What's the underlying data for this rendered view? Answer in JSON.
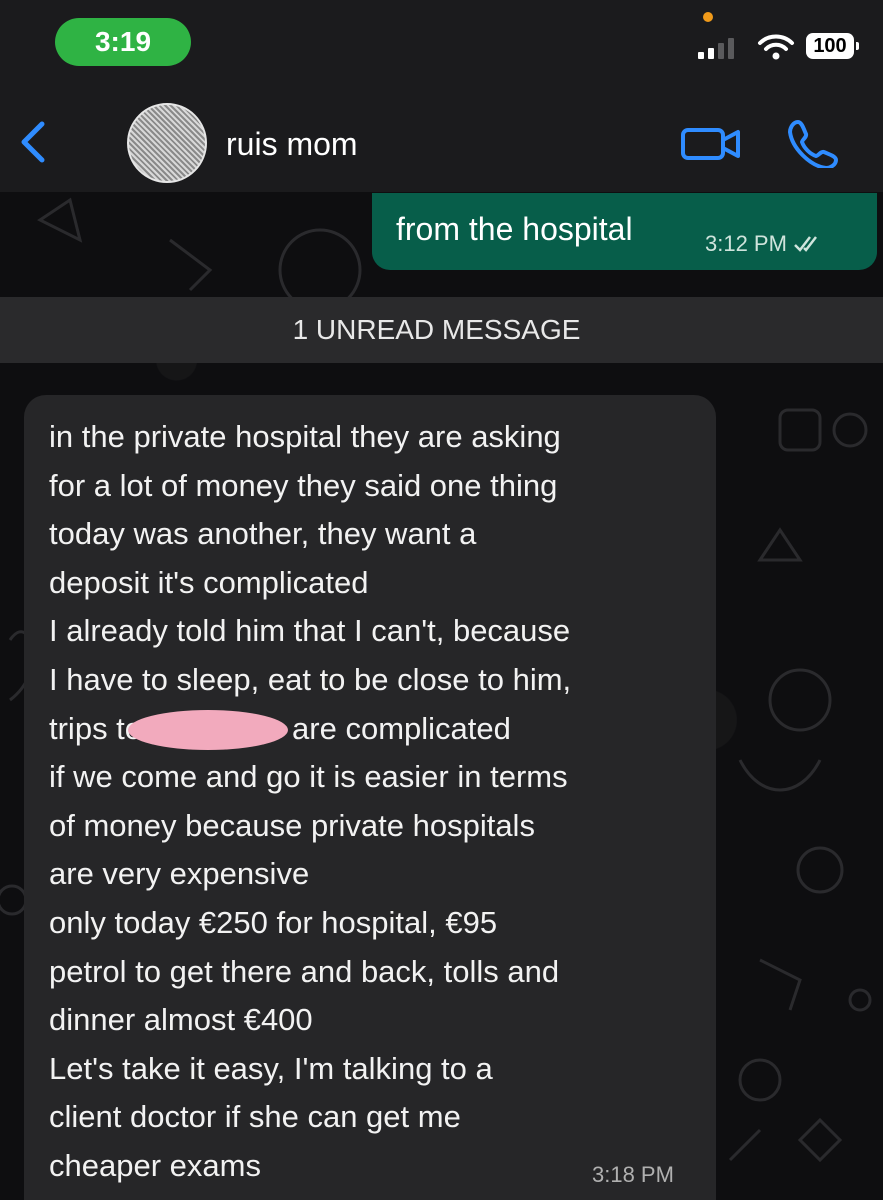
{
  "status_bar": {
    "time": "3:19",
    "battery": "100"
  },
  "header": {
    "contact_name": "ruis mom"
  },
  "messages": {
    "outgoing": {
      "text": "from the hospital",
      "time": "3:12 PM"
    },
    "unread_divider": "1 UNREAD MESSAGE",
    "incoming": {
      "lines": [
        "in the private hospital they are asking",
        "for a lot of money they said one thing",
        "today was another, they want a",
        "deposit it's complicated",
        "I already told him that I can't, because",
        "I have to sleep, eat to be close to him,",
        "trips to",
        "are complicated",
        "if we come and go it is easier in terms",
        "of money because private hospitals",
        "are very expensive",
        "only today €250 for hospital, €95",
        "petrol to get there and back, tolls and",
        "dinner almost €400",
        "Let's take it easy, I'm talking to a",
        "client doctor if she can get me",
        "cheaper exams"
      ],
      "time": "3:18 PM"
    }
  },
  "colors": {
    "status_pill": "#2fb344",
    "accent_blue": "#2f8cff",
    "outgoing_bubble": "#075e4a",
    "incoming_bubble": "#262628",
    "redaction": "#f2aabd"
  },
  "icons": {
    "back": "chevron-left-icon",
    "video": "video-camera-icon",
    "call": "phone-icon",
    "signal": "cellular-signal-icon",
    "wifi": "wifi-icon",
    "read": "double-check-icon"
  }
}
